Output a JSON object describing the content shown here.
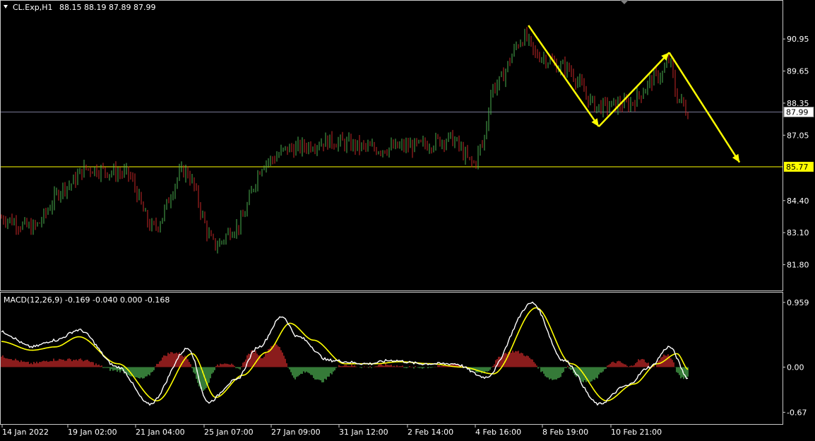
{
  "header": {
    "menu_icon": "triangle-down-icon",
    "symbol": "CL.Exp,H1",
    "ohlc": "88.15 88.19 87.89 87.99"
  },
  "macd_header": "MACD(12,26,9) -0.169 -0.040 0.000 -0.168",
  "colors": {
    "background": "#000000",
    "bull": "#4caf50",
    "bear": "#c62828",
    "macd_line": "#ffffff",
    "signal_line": "#ffff00",
    "annotation": "#ffff00",
    "support_line": "#ffff00",
    "price_line": "#a0a0c8"
  },
  "price_labels": [
    "90.95",
    "89.65",
    "88.35",
    "87.05",
    "85.77",
    "84.40",
    "83.10",
    "81.80"
  ],
  "current_price": "87.99",
  "support_price": "85.77",
  "macd_labels": [
    "0.959",
    "0.00",
    "-0.67"
  ],
  "time_labels": [
    "14 Jan 2022",
    "19 Jan 02:00",
    "21 Jan 04:00",
    "25 Jan 07:00",
    "27 Jan 09:00",
    "31 Jan 12:00",
    "2 Feb 14:00",
    "4 Feb 16:00",
    "8 Feb 19:00",
    "10 Feb 21:00"
  ],
  "chart_data": [
    {
      "type": "candlestick",
      "symbol": "CL.Exp",
      "timeframe": "H1",
      "ylim": [
        81.3,
        91.9
      ],
      "current_price": 87.99,
      "horizontal_lines": [
        87.99,
        85.77
      ],
      "series_anchors": [
        {
          "t": 0,
          "v": 83.7
        },
        {
          "t": 0.04,
          "v": 83.3
        },
        {
          "t": 0.085,
          "v": 85.0
        },
        {
          "t": 0.11,
          "v": 85.7
        },
        {
          "t": 0.16,
          "v": 85.5
        },
        {
          "t": 0.195,
          "v": 83.3
        },
        {
          "t": 0.235,
          "v": 85.6
        },
        {
          "t": 0.275,
          "v": 82.6
        },
        {
          "t": 0.3,
          "v": 83.3
        },
        {
          "t": 0.34,
          "v": 86.0
        },
        {
          "t": 0.37,
          "v": 86.5
        },
        {
          "t": 0.42,
          "v": 86.8
        },
        {
          "t": 0.48,
          "v": 86.5
        },
        {
          "t": 0.53,
          "v": 86.6
        },
        {
          "t": 0.575,
          "v": 86.9
        },
        {
          "t": 0.605,
          "v": 85.9
        },
        {
          "t": 0.615,
          "v": 86.6
        },
        {
          "t": 0.63,
          "v": 89.0
        },
        {
          "t": 0.67,
          "v": 91.0
        },
        {
          "t": 0.685,
          "v": 90.3
        },
        {
          "t": 0.72,
          "v": 89.8
        },
        {
          "t": 0.765,
          "v": 88.2
        },
        {
          "t": 0.8,
          "v": 88.3
        },
        {
          "t": 0.845,
          "v": 89.5
        },
        {
          "t": 0.855,
          "v": 90.1
        },
        {
          "t": 0.865,
          "v": 88.6
        },
        {
          "t": 0.88,
          "v": 87.99
        }
      ],
      "annotation_arrows": [
        {
          "from": {
            "t": 0.675,
            "v": 91.5
          },
          "to": {
            "t": 0.765,
            "v": 87.4
          }
        },
        {
          "from": {
            "t": 0.765,
            "v": 87.4
          },
          "to": {
            "t": 0.855,
            "v": 90.4
          }
        },
        {
          "from": {
            "t": 0.855,
            "v": 90.4
          },
          "to": {
            "t": 0.945,
            "v": 85.95
          }
        }
      ]
    },
    {
      "type": "macd",
      "params": [
        12,
        26,
        9
      ],
      "values": {
        "macd": -0.169,
        "signal": -0.04,
        "zero": 0.0,
        "hist": -0.168
      },
      "ylim": [
        -0.75,
        1.0
      ],
      "macd_anchors": [
        {
          "t": 0,
          "v": 0.52
        },
        {
          "t": 0.04,
          "v": 0.3
        },
        {
          "t": 0.07,
          "v": 0.4
        },
        {
          "t": 0.1,
          "v": 0.55
        },
        {
          "t": 0.15,
          "v": 0.0
        },
        {
          "t": 0.19,
          "v": -0.55
        },
        {
          "t": 0.24,
          "v": 0.28
        },
        {
          "t": 0.265,
          "v": -0.52
        },
        {
          "t": 0.3,
          "v": -0.2
        },
        {
          "t": 0.33,
          "v": 0.3
        },
        {
          "t": 0.36,
          "v": 0.75
        },
        {
          "t": 0.38,
          "v": 0.45
        },
        {
          "t": 0.42,
          "v": 0.1
        },
        {
          "t": 0.47,
          "v": 0.05
        },
        {
          "t": 0.5,
          "v": 0.1
        },
        {
          "t": 0.54,
          "v": 0.05
        },
        {
          "t": 0.58,
          "v": 0.05
        },
        {
          "t": 0.62,
          "v": -0.15
        },
        {
          "t": 0.68,
          "v": 0.95
        },
        {
          "t": 0.72,
          "v": 0.1
        },
        {
          "t": 0.765,
          "v": -0.55
        },
        {
          "t": 0.8,
          "v": -0.28
        },
        {
          "t": 0.83,
          "v": 0.0
        },
        {
          "t": 0.855,
          "v": 0.3
        },
        {
          "t": 0.88,
          "v": -0.169
        }
      ],
      "signal_anchors": [
        {
          "t": 0,
          "v": 0.38
        },
        {
          "t": 0.04,
          "v": 0.25
        },
        {
          "t": 0.07,
          "v": 0.3
        },
        {
          "t": 0.1,
          "v": 0.45
        },
        {
          "t": 0.15,
          "v": 0.05
        },
        {
          "t": 0.2,
          "v": -0.5
        },
        {
          "t": 0.245,
          "v": 0.2
        },
        {
          "t": 0.275,
          "v": -0.45
        },
        {
          "t": 0.31,
          "v": -0.12
        },
        {
          "t": 0.34,
          "v": 0.22
        },
        {
          "t": 0.37,
          "v": 0.65
        },
        {
          "t": 0.4,
          "v": 0.4
        },
        {
          "t": 0.44,
          "v": 0.05
        },
        {
          "t": 0.48,
          "v": 0.05
        },
        {
          "t": 0.51,
          "v": 0.08
        },
        {
          "t": 0.55,
          "v": 0.05
        },
        {
          "t": 0.59,
          "v": 0.0
        },
        {
          "t": 0.63,
          "v": -0.1
        },
        {
          "t": 0.685,
          "v": 0.88
        },
        {
          "t": 0.73,
          "v": 0.05
        },
        {
          "t": 0.775,
          "v": -0.5
        },
        {
          "t": 0.81,
          "v": -0.25
        },
        {
          "t": 0.84,
          "v": 0.05
        },
        {
          "t": 0.865,
          "v": 0.2
        },
        {
          "t": 0.88,
          "v": -0.04
        }
      ]
    }
  ]
}
